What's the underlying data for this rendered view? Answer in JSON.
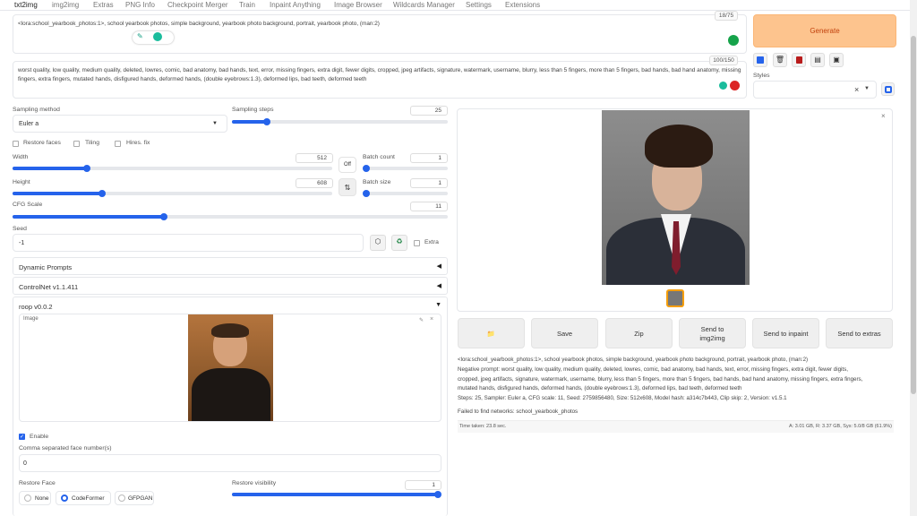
{
  "tabs": [
    "txt2img",
    "img2img",
    "Extras",
    "PNG Info",
    "Checkpoint Merger",
    "Train",
    "Inpaint Anything",
    "Image Browser",
    "Wildcards Manager",
    "Settings",
    "Extensions"
  ],
  "prompt": {
    "positive": "<lora:school_yearbook_photos:1>, school yearbook photos, simple background, yearbook photo background, portrait, yearbook photo, (man:2)",
    "positive_counter": "18/75",
    "negative": "worst quality, low quality, medium quality, deleted, lowres, comic, bad anatomy, bad hands, text, error, missing fingers, extra digit, fewer digits, cropped, jpeg artifacts, signature, watermark, username, blurry, less than 5 fingers, more than 5 fingers, bad hands, bad hand anatomy, missing fingers, extra fingers, mutated hands, disfigured hands, deformed hands, (double eyebrows:1.3), deformed lips, bad teeth, deformed teeth",
    "negative_counter": "100/150"
  },
  "generate_label": "Generate",
  "styles_label": "Styles",
  "styles_clear": "×",
  "params": {
    "sampling_method_label": "Sampling method",
    "sampling_method_value": "Euler a",
    "sampling_steps_label": "Sampling steps",
    "sampling_steps_value": "25",
    "sampling_steps_fraction": 0.16,
    "restore_faces": "Restore faces",
    "tiling": "Tiling",
    "hires_fix": "Hires. fix",
    "width_label": "Width",
    "width_value": "512",
    "height_label": "Height",
    "height_value": "608",
    "batch_count_label": "Batch count",
    "batch_count_value": "1",
    "batch_size_label": "Batch size",
    "batch_size_value": "1",
    "off_label": "Off",
    "swap_icon": "⇅",
    "cfg_label": "CFG Scale",
    "cfg_value": "11",
    "seed_label": "Seed",
    "seed_value": "-1",
    "extra_label": "Extra"
  },
  "accordions": {
    "dynamic_prompts": "Dynamic Prompts",
    "controlnet": "ControlNet v1.1.411",
    "roop": "roop v0.0.2"
  },
  "roop": {
    "image_label": "Image",
    "enable_label": "Enable",
    "face_numbers_label": "Comma separated face number(s)",
    "face_numbers_value": "0",
    "restore_face_label": "Restore Face",
    "restore_options": [
      "None",
      "CodeFormer",
      "GFPGAN"
    ],
    "restore_selected": "CodeFormer",
    "restore_visibility_label": "Restore visibility",
    "restore_visibility_value": "1"
  },
  "output": {
    "close": "×",
    "buttons": {
      "folder": "📁",
      "save": "Save",
      "zip": "Zip",
      "send_img2img": "Send to img2img",
      "send_inpaint": "Send to inpaint",
      "send_extras": "Send to extras"
    },
    "info_prompt": "<lora:school_yearbook_photos:1>, school yearbook photos, simple background, yearbook photo background, portrait, yearbook photo, (man:2)",
    "info_negative_1": "Negative prompt: worst quality, low quality, medium quality, deleted, lowres, comic, bad anatomy, bad hands, text, error, missing fingers, extra digit, fewer digits,",
    "info_negative_2": "cropped, jpeg artifacts, signature, watermark, username, blurry, less than 5 fingers, more than 5 fingers, bad hands, bad hand anatomy, missing fingers, extra fingers,",
    "info_negative_3": "mutated hands, disfigured hands, deformed hands, (double eyebrows:1.3), deformed lips, bad teeth, deformed teeth",
    "info_params": "Steps: 25, Sampler: Euler a, CFG scale: 11, Seed: 2759856480, Size: 512x608, Model hash: a314c7b443, Clip skip: 2, Version: v1.5.1",
    "info_error": "Failed to find networks: school_yearbook_photos",
    "time_taken": "Time taken: 23.8 sec.",
    "vram": "A: 3.01 GB, R: 3.37 GB, Sys: 5.0/8 GB (61.9%)"
  },
  "colors": {
    "accent": "#2563eb",
    "generate": "#fcc58c"
  }
}
